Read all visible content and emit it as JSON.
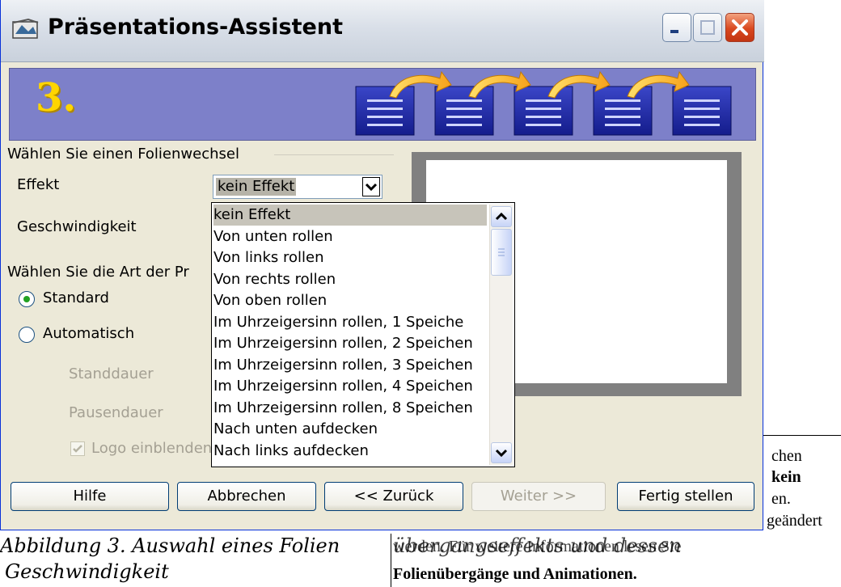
{
  "window": {
    "title": "Präsentations-Assistent"
  },
  "banner": {
    "step": "3."
  },
  "transition": {
    "group_label": "Wählen Sie einen Folienwechsel",
    "effect_label": "Effekt",
    "effect_value": "kein Effekt",
    "speed_label": "Geschwindigkeit"
  },
  "presentation": {
    "group_label": "Wählen Sie die Art der Pr",
    "standard_label": "Standard",
    "automatic_label": "Automatisch",
    "duration_label": "Standdauer",
    "pause_label": "Pausendauer",
    "logo_label": "Logo einblenden"
  },
  "dropdown": {
    "items": [
      "kein Effekt",
      "Von unten rollen",
      "Von links rollen",
      "Von rechts rollen",
      "Von oben rollen",
      "Im Uhrzeigersinn rollen, 1 Speiche",
      "Im Uhrzeigersinn rollen, 2 Speichen",
      "Im Uhrzeigersinn rollen, 3 Speichen",
      "Im Uhrzeigersinn rollen, 4 Speichen",
      "Im Uhrzeigersinn rollen, 8 Speichen",
      "Nach unten aufdecken",
      "Nach links aufdecken"
    ]
  },
  "buttons": {
    "help": "Hilfe",
    "cancel": "Abbrechen",
    "back": "<< Zurück",
    "next": "Weiter >>",
    "finish": "Fertig stellen"
  },
  "document": {
    "caption_line1": "Abbildung 3. Auswahl eines Folien",
    "caption_line2": "Geschwindigkeit",
    "caption_overlap": "übergangseffekts und dessen",
    "side_1": "chen",
    "side_2": "kein",
    "side_3": "en.",
    "side_4": "geändert",
    "body_line1": "werden. Für weitere Informationen lesen Sie",
    "body_line2": "Folienübergänge und Animationen."
  },
  "colors": {
    "banner": "#7d80c9",
    "banner_number": "#ffd500",
    "dialog_bg": "#ece9d8",
    "selected_item": "#c7c4ba"
  }
}
